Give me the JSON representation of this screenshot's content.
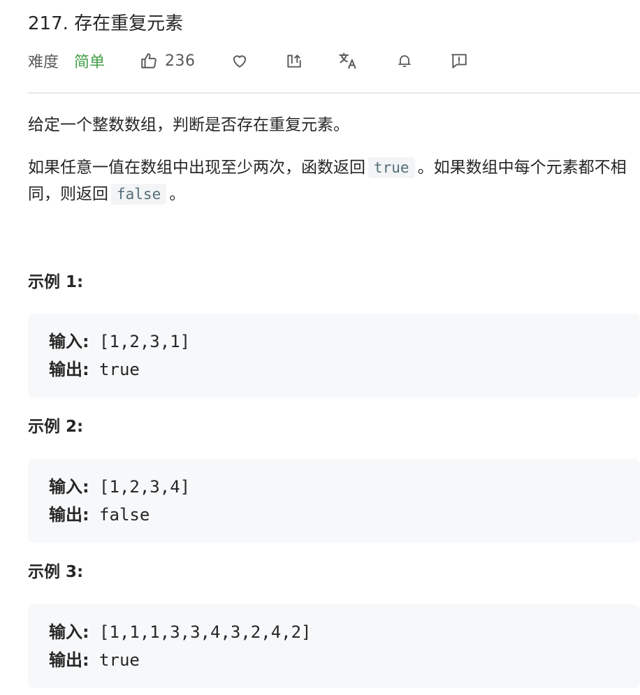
{
  "problem": {
    "title": "217. 存在重复元素",
    "difficulty_label": "难度",
    "difficulty_value": "简单",
    "difficulty_color": "#43a047",
    "likes": "236",
    "icons": [
      "thumbs-up-icon",
      "heart-icon",
      "share-icon",
      "translate-icon",
      "bell-icon",
      "feedback-icon"
    ]
  },
  "description": {
    "line1": "给定一个整数数组，判断是否存在重复元素。",
    "p2_part1": "如果任意一值在数组中出现至少两次，函数返回",
    "p2_code1": "true",
    "p2_part2": "。如果数组中每个元素都不相同，则返回",
    "p2_code2": "false",
    "p2_part3": "。"
  },
  "examples": [
    {
      "title": "示例 1:",
      "input_label": "输入:",
      "input_value": " [1,2,3,1]",
      "output_label": "输出:",
      "output_value": " true"
    },
    {
      "title": "示例 2:",
      "input_label": "输入:",
      "input_value": " [1,2,3,4]",
      "output_label": "输出:",
      "output_value": " false"
    },
    {
      "title": "示例 3:",
      "input_label": "输入:",
      "input_value": " [1,1,1,3,3,4,3,2,4,2]",
      "output_label": "输出:",
      "output_value": " true"
    }
  ]
}
